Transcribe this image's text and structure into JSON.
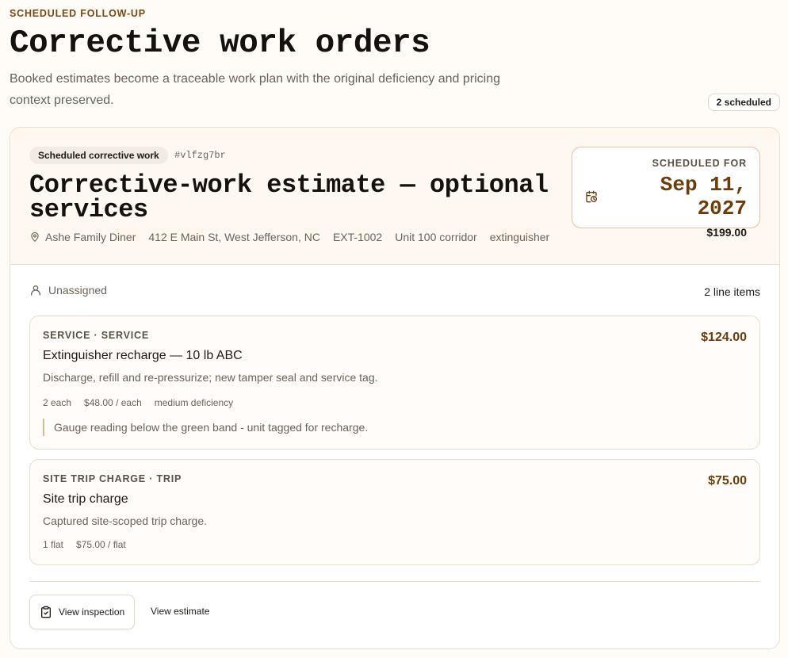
{
  "header": {
    "eyebrow": "SCHEDULED FOLLOW-UP",
    "title": "Corrective work orders",
    "subtitle": "Booked estimates become a traceable work plan with the original deficiency and pricing context preserved.",
    "count_badge": "2 scheduled"
  },
  "work_order": {
    "type_chip": "Scheduled corrective work",
    "ref": "#vlfzg7br",
    "title": "Corrective-work estimate — optional services",
    "meta": {
      "customer": "Ashe Family Diner",
      "address": "412 E Main St, West Jefferson, NC",
      "asset_id": "EXT-1002",
      "location": "Unit 100 corridor",
      "asset_type": "extinguisher"
    },
    "schedule": {
      "label": "SCHEDULED FOR",
      "date": "Sep 11, 2027",
      "total": "$199.00"
    },
    "assignee": "Unassigned",
    "line_count": "2 line items",
    "items": [
      {
        "kind": "SERVICE · SERVICE",
        "price": "$124.00",
        "name": "Extinguisher recharge — 10 lb ABC",
        "description": "Discharge, refill and re-pressurize; new tamper seal and service tag.",
        "quantity": "2 each",
        "unit_price": "$48.00 / each",
        "severity": "medium deficiency",
        "note": "Gauge reading below the green band - unit tagged for recharge."
      },
      {
        "kind": "SITE TRIP CHARGE · TRIP",
        "price": "$75.00",
        "name": "Site trip charge",
        "description": "Captured site-scoped trip charge.",
        "quantity": "1 flat",
        "unit_price": "$75.00 / flat"
      }
    ],
    "actions": {
      "view_inspection": "View inspection",
      "view_estimate": "View estimate"
    }
  },
  "colors": {
    "accent": "#6b3d0b",
    "eyebrow": "#7a4a12",
    "card_head_bg": "#fff8f1",
    "border": "#ecdcca",
    "note_rule": "#e3b88c"
  },
  "icons": {
    "location": "map-pin-icon",
    "calendar": "calendar-clock-icon",
    "assignee": "user-icon",
    "inspection": "clipboard-check-icon"
  }
}
